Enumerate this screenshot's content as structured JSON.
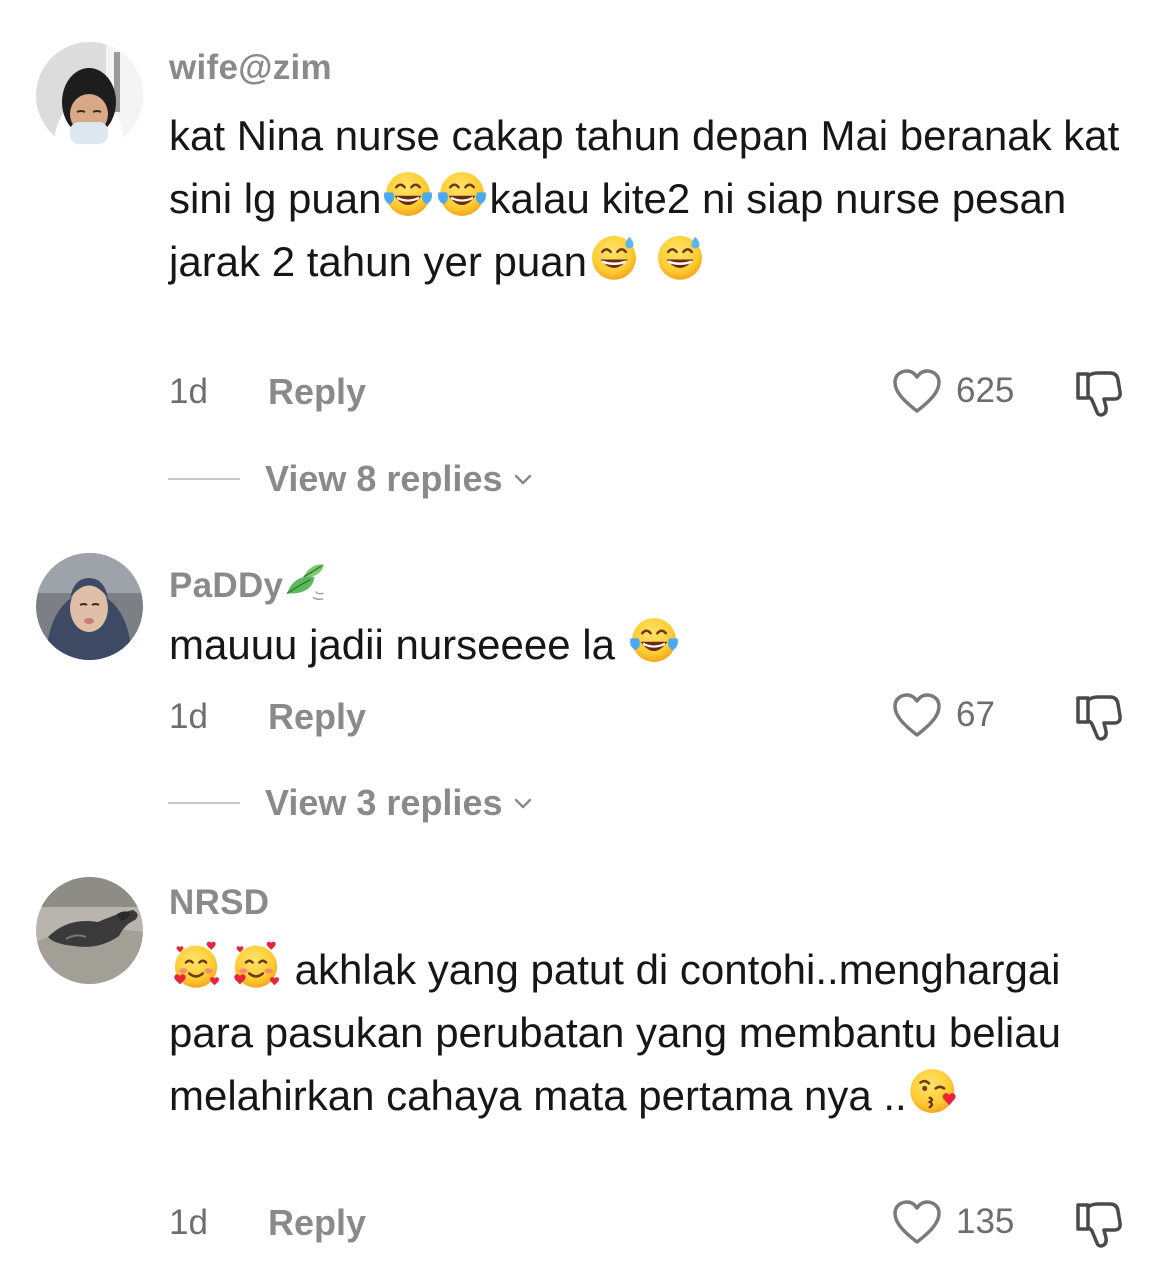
{
  "comments": [
    {
      "username": "wife@zim",
      "text_parts": {
        "p1": "kat Nina nurse cakap tahun depan Mai beranak kat sini lg puan",
        "p2": "kalau kite2 ni siap nurse pesan jarak 2 tahun yer puan"
      },
      "emojis": [
        "face-with-tears-of-joy",
        "face-with-tears-of-joy",
        "grinning-face-with-sweat",
        "grinning-face-with-sweat"
      ],
      "time": "1d",
      "reply_label": "Reply",
      "likes": "625",
      "view_replies": "View 8 replies"
    },
    {
      "username": "PaDDy",
      "username_emoji": "leaf-fluttering-in-wind",
      "text_parts": {
        "p1": "mauuu jadii nurseeee la "
      },
      "emojis": [
        "face-with-tears-of-joy"
      ],
      "time": "1d",
      "reply_label": "Reply",
      "likes": "67",
      "view_replies": "View 3 replies"
    },
    {
      "username": "NRSD",
      "text_parts": {
        "p1": " akhlak yang patut di contohi..menghargai para pasukan perubatan yang membantu beliau melahirkan cahaya mata pertama nya .."
      },
      "emojis": [
        "smiling-face-with-hearts",
        "smiling-face-with-hearts",
        "face-blowing-a-kiss"
      ],
      "time": "1d",
      "reply_label": "Reply",
      "likes": "135"
    }
  ],
  "colors": {
    "username": "#8a8a8a",
    "text": "#161616",
    "meta": "#6d6d6d",
    "divider": "#c8c8c8"
  }
}
